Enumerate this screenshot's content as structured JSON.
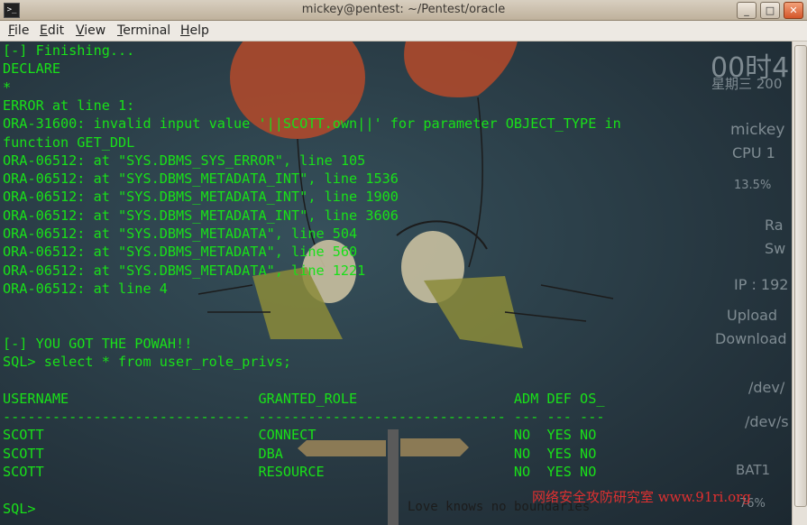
{
  "window": {
    "title": "mickey@pentest: ~/Pentest/oracle",
    "controls": {
      "minimize": "_",
      "maximize": "□",
      "close": "✕"
    }
  },
  "menu": [
    {
      "label": "File",
      "u": "F",
      "rest": "ile"
    },
    {
      "label": "Edit",
      "u": "E",
      "rest": "dit"
    },
    {
      "label": "View",
      "u": "V",
      "rest": "iew"
    },
    {
      "label": "Terminal",
      "u": "T",
      "rest": "erminal"
    },
    {
      "label": "Help",
      "u": "H",
      "rest": "elp"
    }
  ],
  "terminal": {
    "lines": [
      "[-] Finishing...",
      "DECLARE",
      "*",
      "ERROR at line 1:",
      "ORA-31600: invalid input value '||SCOTT.own||' for parameter OBJECT_TYPE in",
      "function GET_DDL",
      "ORA-06512: at \"SYS.DBMS_SYS_ERROR\", line 105",
      "ORA-06512: at \"SYS.DBMS_METADATA_INT\", line 1536",
      "ORA-06512: at \"SYS.DBMS_METADATA_INT\", line 1900",
      "ORA-06512: at \"SYS.DBMS_METADATA_INT\", line 3606",
      "ORA-06512: at \"SYS.DBMS_METADATA\", line 504",
      "ORA-06512: at \"SYS.DBMS_METADATA\", line 560",
      "ORA-06512: at \"SYS.DBMS_METADATA\", line 1221",
      "ORA-06512: at line 4",
      "",
      "",
      "[-] YOU GOT THE POWAH!!",
      "SQL> select * from user_role_privs;",
      "",
      "USERNAME                       GRANTED_ROLE                   ADM DEF OS_",
      "------------------------------ ------------------------------ --- --- ---",
      "SCOTT                          CONNECT                        NO  YES NO",
      "SCOTT                          DBA                            NO  YES NO",
      "SCOTT                          RESOURCE                       NO  YES NO",
      "",
      "SQL>"
    ]
  },
  "desktop_widgets": {
    "clock": "00时4",
    "date": "星期三 200",
    "user": "mickey",
    "cpu": "CPU 1",
    "cpu_percent": "13.5%",
    "ram": "Ra",
    "swap": "Sw",
    "ip": "IP : 192",
    "upload": "Upload",
    "download": "Download",
    "dev1": "/dev/",
    "dev2": "/dev/s",
    "battery": "BAT1",
    "battery_percent": "76%"
  },
  "wallpaper_text": "Love knows no boundaries",
  "watermark": "网络安全攻防研究室 www.91ri.org",
  "colors": {
    "terminal_text": "#19e019",
    "watermark": "#e03030"
  }
}
